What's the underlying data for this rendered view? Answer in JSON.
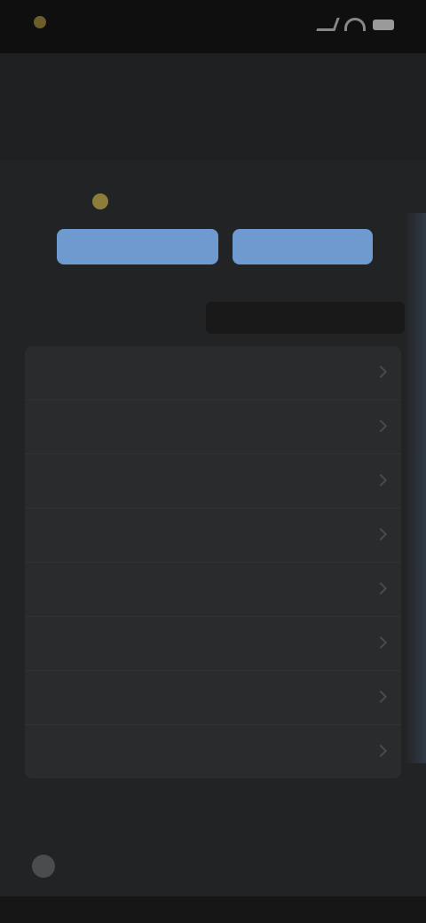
{
  "status_bar": {
    "time": "",
    "icons": [
      "signal-icon",
      "wifi-icon",
      "battery-icon"
    ]
  },
  "header": {
    "title": "",
    "right_action": ""
  },
  "banner": {
    "message": "",
    "button_primary": "",
    "button_secondary": "",
    "button_color": "#6e9ad0"
  },
  "section": {
    "caption": ""
  },
  "list": {
    "items": [
      {
        "label": ""
      },
      {
        "label": ""
      },
      {
        "label": ""
      },
      {
        "label": ""
      },
      {
        "label": ""
      },
      {
        "label": ""
      },
      {
        "label": ""
      },
      {
        "label": ""
      }
    ]
  },
  "footer": {
    "title": "",
    "row_text": ""
  }
}
